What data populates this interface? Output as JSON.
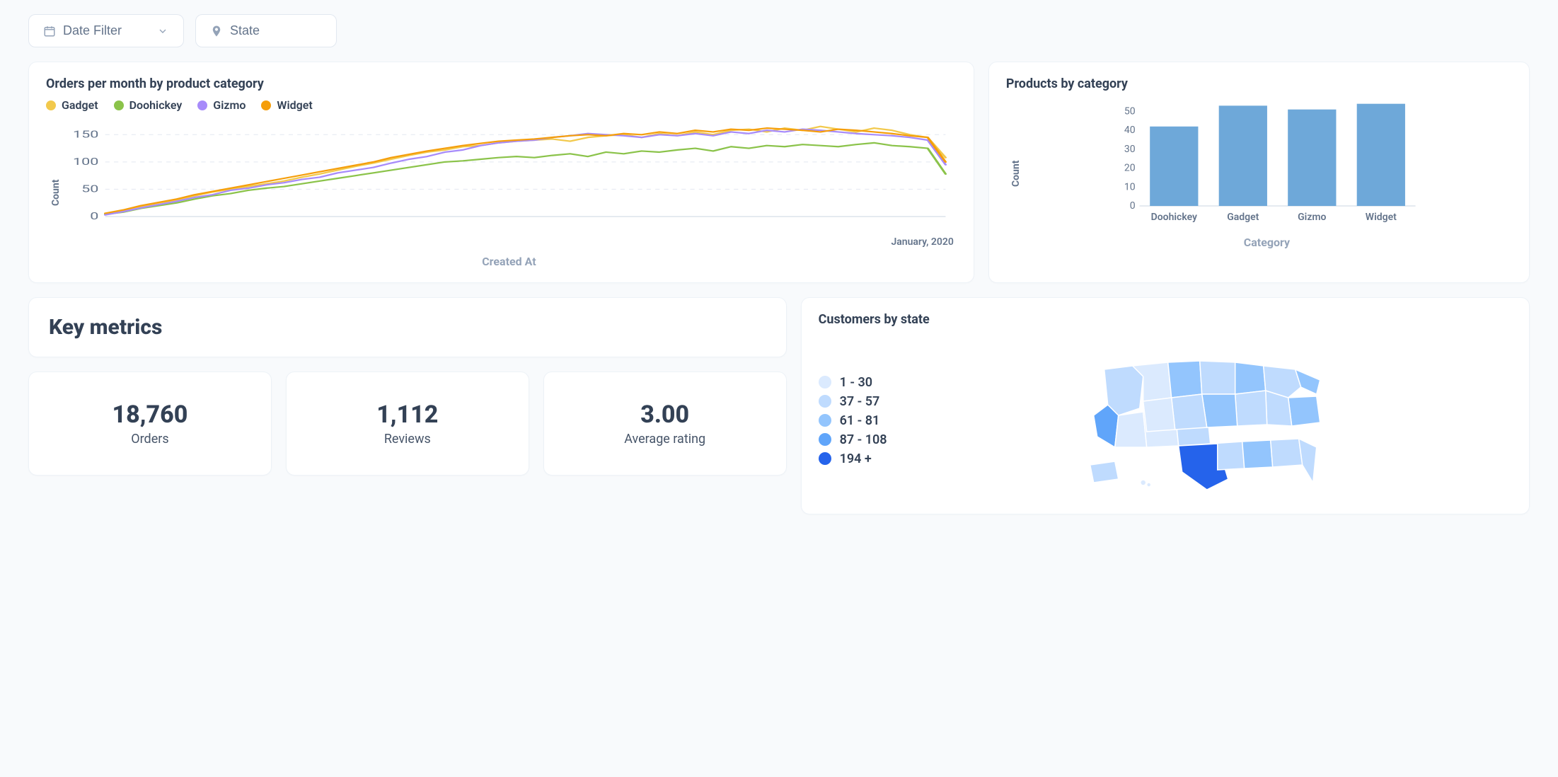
{
  "filters": {
    "date_label": "Date Filter",
    "state_label": "State"
  },
  "line_card_title": "Orders per month by product category",
  "bar_card_title": "Products by category",
  "map_card_title": "Customers by state",
  "key_metrics_title": "Key metrics",
  "metrics": [
    {
      "value": "18,760",
      "label": "Orders"
    },
    {
      "value": "1,112",
      "label": "Reviews"
    },
    {
      "value": "3.00",
      "label": "Average rating"
    }
  ],
  "map_legend": [
    {
      "label": "1 - 30",
      "color": "#dbeafe"
    },
    {
      "label": "37 - 57",
      "color": "#bfdbfe"
    },
    {
      "label": "61 - 81",
      "color": "#93c5fd"
    },
    {
      "label": "87 - 108",
      "color": "#60a5fa"
    },
    {
      "label": "194 +",
      "color": "#2563eb"
    }
  ],
  "chart_data": [
    {
      "id": "orders_per_month",
      "type": "line",
      "title": "Orders per month by product category",
      "xlabel": "Created At",
      "ylabel": "Count",
      "x_end_label": "January, 2020",
      "ylim": [
        0,
        175
      ],
      "yticks": [
        0,
        50,
        100,
        150
      ],
      "legend": [
        "Gadget",
        "Doohickey",
        "Gizmo",
        "Widget"
      ],
      "colors": {
        "Gadget": "#f2c94c",
        "Doohickey": "#8bc34a",
        "Gizmo": "#a78bfa",
        "Widget": "#f59e0b"
      },
      "x": [
        0,
        1,
        2,
        3,
        4,
        5,
        6,
        7,
        8,
        9,
        10,
        11,
        12,
        13,
        14,
        15,
        16,
        17,
        18,
        19,
        20,
        21,
        22,
        23,
        24,
        25,
        26,
        27,
        28,
        29,
        30,
        31,
        32,
        33,
        34,
        35,
        36,
        37,
        38,
        39,
        40,
        41,
        42,
        43,
        44,
        45,
        46,
        47
      ],
      "series": [
        {
          "name": "Gadget",
          "values": [
            5,
            10,
            18,
            25,
            30,
            38,
            45,
            50,
            55,
            60,
            65,
            72,
            78,
            85,
            92,
            98,
            105,
            112,
            118,
            122,
            128,
            130,
            135,
            138,
            140,
            142,
            138,
            145,
            148,
            150,
            145,
            152,
            148,
            155,
            150,
            158,
            160,
            155,
            162,
            158,
            165,
            160,
            155,
            162,
            158,
            150,
            145,
            108
          ]
        },
        {
          "name": "Doohickey",
          "values": [
            4,
            8,
            15,
            20,
            25,
            32,
            38,
            42,
            48,
            52,
            55,
            60,
            65,
            70,
            75,
            80,
            85,
            90,
            95,
            100,
            102,
            105,
            108,
            110,
            108,
            112,
            115,
            110,
            118,
            115,
            120,
            118,
            122,
            125,
            120,
            128,
            125,
            130,
            128,
            132,
            130,
            128,
            132,
            135,
            130,
            128,
            125,
            78
          ]
        },
        {
          "name": "Gizmo",
          "values": [
            3,
            9,
            16,
            22,
            28,
            35,
            40,
            48,
            52,
            58,
            62,
            68,
            72,
            80,
            85,
            90,
            98,
            105,
            110,
            118,
            122,
            130,
            135,
            138,
            140,
            145,
            148,
            152,
            150,
            148,
            145,
            150,
            148,
            152,
            148,
            155,
            152,
            158,
            155,
            160,
            158,
            155,
            152,
            150,
            148,
            145,
            140,
            95
          ]
        },
        {
          "name": "Widget",
          "values": [
            6,
            12,
            20,
            26,
            32,
            40,
            46,
            52,
            58,
            64,
            70,
            76,
            82,
            88,
            94,
            100,
            108,
            114,
            120,
            125,
            130,
            134,
            138,
            140,
            142,
            145,
            148,
            150,
            148,
            152,
            150,
            155,
            152,
            158,
            155,
            160,
            158,
            162,
            160,
            158,
            155,
            160,
            158,
            155,
            152,
            148,
            145,
            100
          ]
        }
      ]
    },
    {
      "id": "products_by_category",
      "type": "bar",
      "title": "Products by category",
      "xlabel": "Category",
      "ylabel": "Count",
      "ylim": [
        0,
        55
      ],
      "yticks": [
        0,
        10,
        20,
        30,
        40,
        50
      ],
      "categories": [
        "Doohickey",
        "Gadget",
        "Gizmo",
        "Widget"
      ],
      "values": [
        42,
        53,
        51,
        54
      ],
      "bar_color": "#6ea8d9"
    }
  ]
}
